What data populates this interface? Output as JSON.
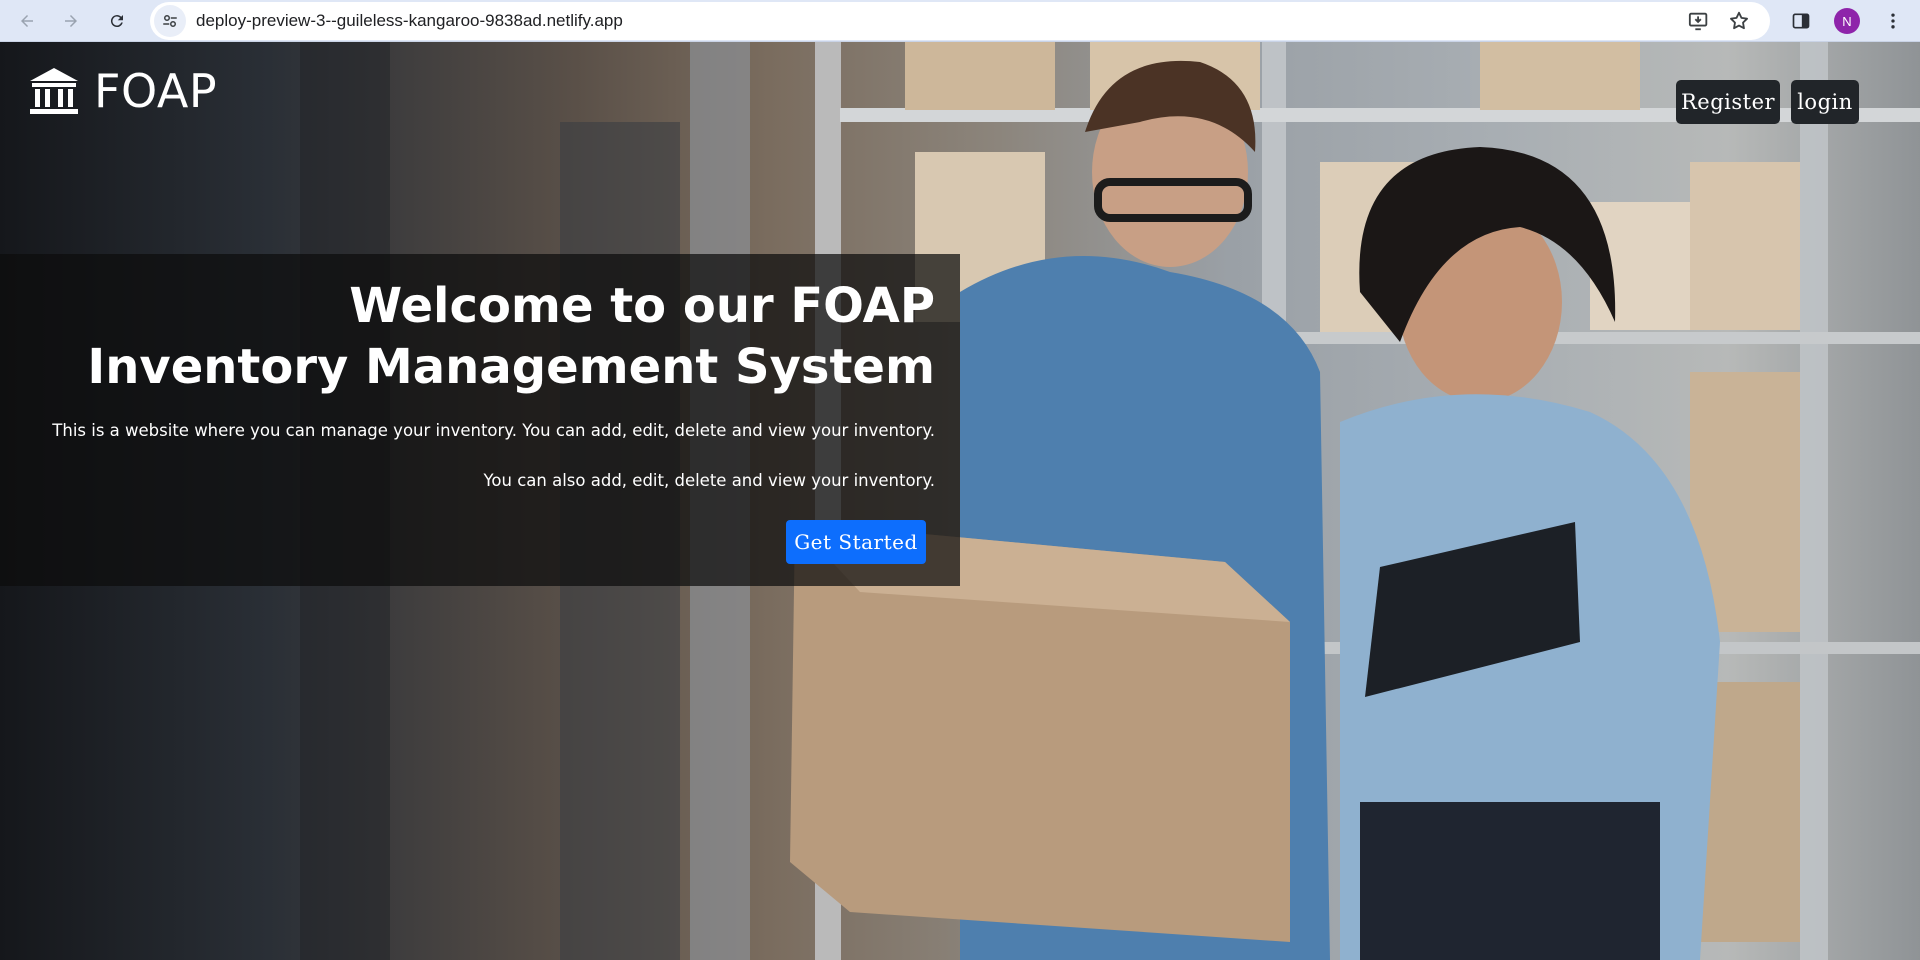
{
  "browser": {
    "url": "deploy-preview-3--guileless-kangaroo-9838ad.netlify.app",
    "profile_initial": "N",
    "profile_color": "#8e24aa"
  },
  "header": {
    "brand": "FOAP",
    "register_label": "Register",
    "login_label": "login"
  },
  "hero": {
    "title": "Welcome to our FOAP Inventory Management System",
    "paragraph_1": "This is a website where you can manage your inventory. You can add, edit, delete and view your inventory.",
    "paragraph_2": "You can also add, edit, delete and view your inventory.",
    "cta_label": "Get Started",
    "cta_color": "#0d6efd"
  },
  "icons": {
    "back": "arrow-left-icon",
    "forward": "arrow-right-icon",
    "reload": "reload-icon",
    "site_info": "tune-icon",
    "install": "install-app-icon",
    "bookmark": "star-icon",
    "side_panel": "side-panel-icon",
    "menu": "kebab-menu-icon",
    "brand": "bank-building-icon"
  }
}
